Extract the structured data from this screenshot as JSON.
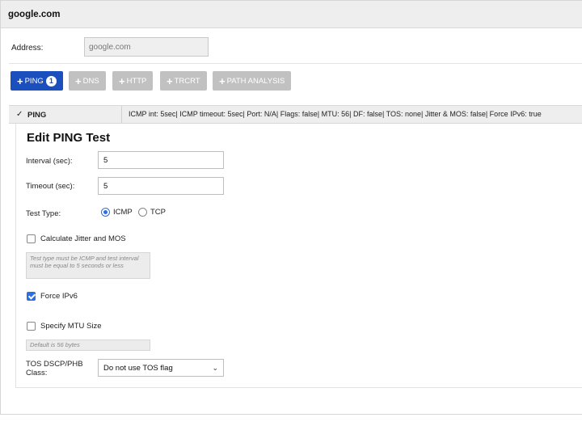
{
  "window": {
    "title": "google.com"
  },
  "address": {
    "label": "Address:",
    "value": "google.com"
  },
  "tabs": [
    {
      "label": "PING",
      "plus": "+",
      "badge": "1",
      "active": true
    },
    {
      "label": "DNS",
      "plus": "+",
      "active": false
    },
    {
      "label": "HTTP",
      "plus": "+",
      "active": false
    },
    {
      "label": "TRCRT",
      "plus": "+",
      "active": false
    },
    {
      "label": "PATH ANALYSIS",
      "plus": "+",
      "active": false
    }
  ],
  "ping_row": {
    "chevron": "✓",
    "label": "PING",
    "summary": "ICMP int: 5sec| ICMP timeout: 5sec| Port: N/A| Flags: false| MTU: 56| DF: false| TOS: none| Jitter & MOS: false| Force IPv6: true"
  },
  "edit": {
    "title": "Edit PING Test",
    "interval": {
      "label": "Interval (sec):",
      "value": "5"
    },
    "timeout": {
      "label": "Timeout (sec):",
      "value": "5"
    },
    "test_type": {
      "label": "Test Type:",
      "options": [
        "ICMP",
        "TCP"
      ],
      "selected": "ICMP"
    },
    "jitter": {
      "label": "Calculate Jitter and MOS",
      "checked": false,
      "hint": "Test type must be ICMP and test interval must be equal to 5 seconds or less"
    },
    "ipv6": {
      "label": "Force IPv6",
      "checked": true
    },
    "mtu": {
      "label": "Specify MTU Size",
      "checked": false,
      "hint": "Default is 56 bytes"
    },
    "tos": {
      "label": "TOS DSCP/PHB Class:",
      "value": "Do not use TOS flag"
    }
  },
  "colors": {
    "primary": "#1b4fbd",
    "inactive_tab": "#c1c1c1",
    "check_blue": "#2c6ee6"
  }
}
